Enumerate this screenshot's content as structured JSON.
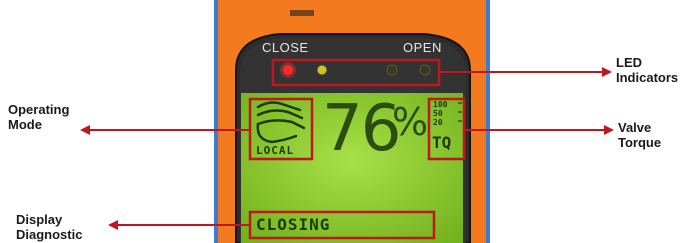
{
  "device": {
    "close_label": "CLOSE",
    "open_label": "OPEN",
    "mode_text": "LOCAL",
    "reading": "76",
    "reading_unit": "%",
    "torque_scale": [
      "100",
      "50",
      "20"
    ],
    "torque_label": "TQ",
    "status_text": "CLOSING",
    "led_colors": [
      "#ff3030",
      "#c8c81e",
      "#3a3a10",
      "#3a3a10"
    ],
    "lcd_color": "#8ccf2e",
    "housing_color": "#f47a20",
    "highlight_color": "#c0171f"
  },
  "callouts": {
    "led": {
      "line1": "LED",
      "line2": "Indicators"
    },
    "mode": {
      "line1": "Operating",
      "line2": "Mode"
    },
    "torque": {
      "line1": "Valve",
      "line2": "Torque"
    },
    "diagnostic": {
      "line1": "Display",
      "line2": "Diagnostic"
    }
  }
}
